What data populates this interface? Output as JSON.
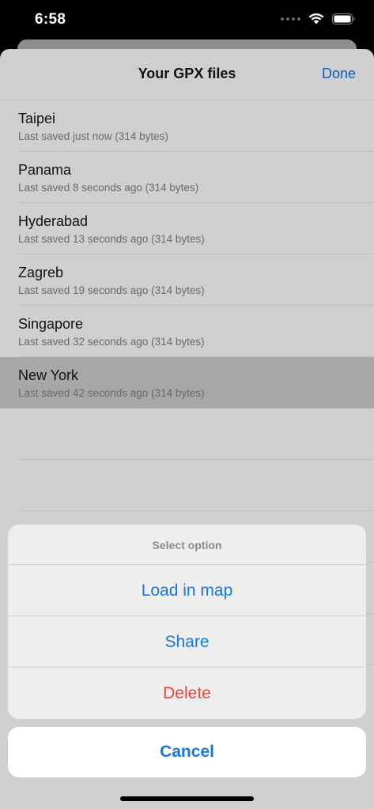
{
  "status_bar": {
    "time": "6:58"
  },
  "nav": {
    "title": "Your GPX files",
    "done_label": "Done"
  },
  "files": [
    {
      "name": "Taipei",
      "subtitle": "Last saved just now (314 bytes)",
      "selected": false
    },
    {
      "name": "Panama",
      "subtitle": "Last saved 8 seconds ago (314 bytes)",
      "selected": false
    },
    {
      "name": "Hyderabad",
      "subtitle": "Last saved 13 seconds ago (314 bytes)",
      "selected": false
    },
    {
      "name": "Zagreb",
      "subtitle": "Last saved 19 seconds ago (314 bytes)",
      "selected": false
    },
    {
      "name": "Singapore",
      "subtitle": "Last saved 32 seconds ago (314 bytes)",
      "selected": false
    },
    {
      "name": "New York",
      "subtitle": "Last saved 42 seconds ago (314 bytes)",
      "selected": true
    }
  ],
  "action_sheet": {
    "header": "Select option",
    "load_label": "Load in map",
    "share_label": "Share",
    "delete_label": "Delete",
    "cancel_label": "Cancel"
  },
  "icons": {
    "wifi": "wifi-icon",
    "battery": "battery-icon",
    "signal": "cellular-signal-icon"
  },
  "colors": {
    "accent": "#1479e4",
    "destructive": "#f0413a"
  }
}
